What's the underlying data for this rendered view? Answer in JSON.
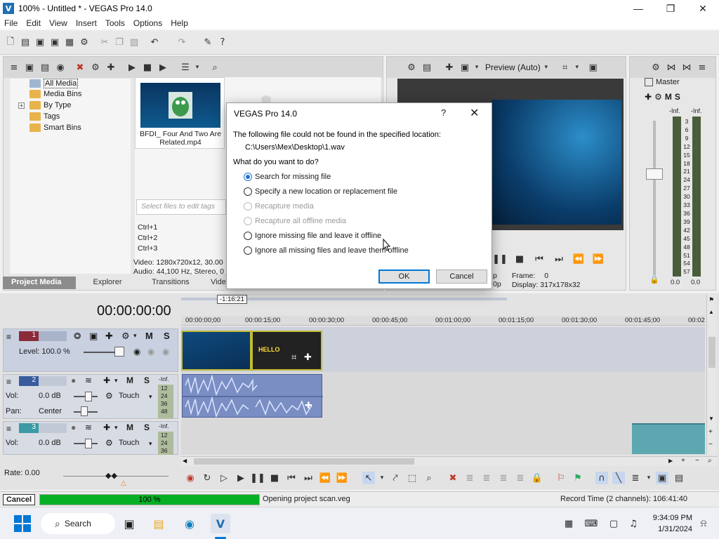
{
  "window": {
    "title": "100% - Untitled * - VEGAS Pro 14.0",
    "minimize": "—",
    "maximize": "❐",
    "close": "✕"
  },
  "menu": [
    "File",
    "Edit",
    "View",
    "Insert",
    "Tools",
    "Options",
    "Help"
  ],
  "project_media": {
    "tree": [
      "All Media",
      "Media Bins",
      "By Type",
      "Tags",
      "Smart Bins"
    ],
    "tree_expander": "+",
    "thumbnail_caption": "BFDI_ Four And Two Are Related.mp4",
    "tags_placeholder": "Select files to edit tags",
    "shortcuts": [
      "Ctrl+1",
      "Ctrl+2",
      "Ctrl+3"
    ],
    "info_video": "Video: 1280x720x12, 30.00",
    "info_audio": "Audio: 44,100 Hz, Stereo, 0",
    "tabs": [
      "Project Media",
      "Explorer",
      "Transitions",
      "Video"
    ]
  },
  "preview": {
    "mode_label": "Preview (Auto)",
    "frame_label": "Frame:",
    "frame_value": "0",
    "display_label": "Display:",
    "display_value": "317x178x32",
    "left_cut_1": "p",
    "left_cut_2": "0p"
  },
  "master": {
    "label": "Master",
    "inf_left": "-Inf.",
    "inf_right": "-Inf.",
    "scale": [
      "3",
      "6",
      "9",
      "12",
      "15",
      "18",
      "21",
      "24",
      "27",
      "30",
      "33",
      "36",
      "39",
      "42",
      "45",
      "48",
      "51",
      "54",
      "57"
    ],
    "bottom_left": "0.0",
    "bottom_right": "0.0"
  },
  "timeline": {
    "timecode": "00:00:00:00",
    "loop_marker": "-1:16:21",
    "ruler": [
      "00:00:00;00",
      "00:00:15;00",
      "00:00:30;00",
      "00:00:45;00",
      "00:01:00;00",
      "00:01:15;00",
      "00:01:30;00",
      "00:01:45;00",
      "00:02"
    ],
    "tracks": [
      {
        "number": "1",
        "level": "Level: 100.0 %",
        "m": "M",
        "s": "S"
      },
      {
        "number": "2",
        "vol_label": "Vol:",
        "vol": "0.0 dB",
        "pan_label": "Pan:",
        "pan": "Center",
        "touch": "Touch",
        "m": "M",
        "s": "S",
        "inf": "-Inf.",
        "scale": [
          "12",
          "24",
          "36",
          "48"
        ]
      },
      {
        "number": "3",
        "vol_label": "Vol:",
        "vol": "0.0 dB",
        "touch": "Touch",
        "m": "M",
        "s": "S",
        "inf": "-Inf.",
        "scale": [
          "12",
          "24",
          "36"
        ]
      }
    ],
    "rate": "Rate: 0.00",
    "clip_text": "HELLO"
  },
  "dialog": {
    "title": "VEGAS Pro 14.0",
    "help": "?",
    "close": "✕",
    "message": "The following file could not be found in the specified location:",
    "path": "C:\\Users\\Mex\\Desktop\\1.wav",
    "question": "What do you want to do?",
    "options": [
      {
        "label": "Search for missing file",
        "checked": true,
        "disabled": false
      },
      {
        "label": "Specify a new location or replacement file",
        "checked": false,
        "disabled": false
      },
      {
        "label": "Recapture media",
        "checked": false,
        "disabled": true
      },
      {
        "label": "Recapture all offline media",
        "checked": false,
        "disabled": true
      },
      {
        "label": "Ignore missing file and leave it offline",
        "checked": false,
        "disabled": false
      },
      {
        "label": "Ignore all missing files and leave them offline",
        "checked": false,
        "disabled": false
      }
    ],
    "ok": "OK",
    "cancel": "Cancel"
  },
  "status": {
    "cancel": "Cancel",
    "progress_percent": 100,
    "progress_label": "100 %",
    "message": "Opening project scan.veg",
    "record_time": "Record Time (2 channels): 106:41:40"
  },
  "taskbar": {
    "search": "Search",
    "time": "9:34:09 PM",
    "date": "1/31/2024"
  },
  "colors": {
    "accent": "#0078d7",
    "progress": "#06b025",
    "vegas_blue": "#1f6fb5"
  }
}
